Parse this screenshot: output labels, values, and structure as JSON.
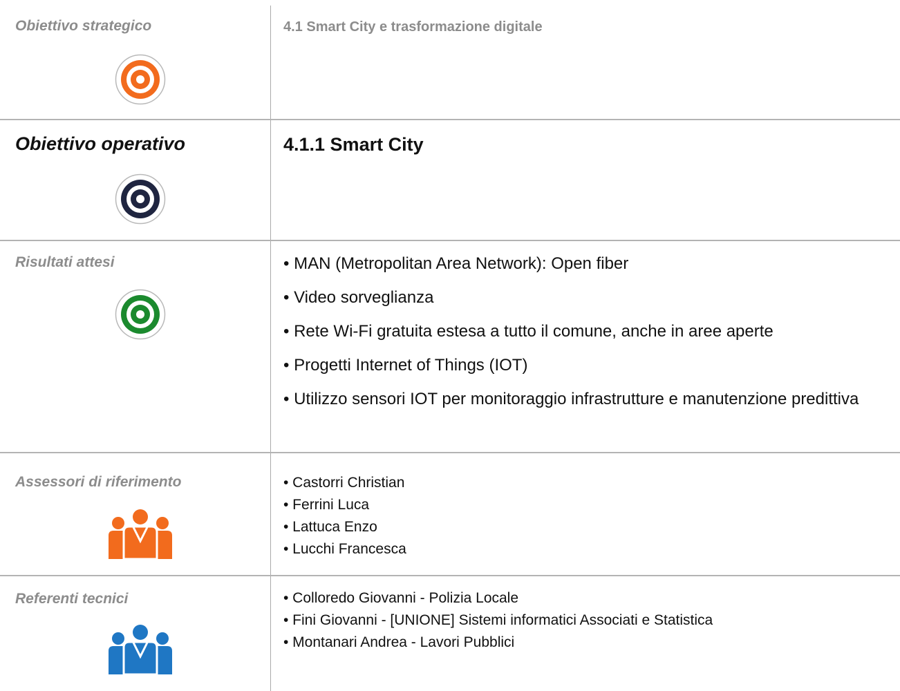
{
  "strategic": {
    "label": "Obiettivo strategico",
    "value": "4.1 Smart City e trasformazione digitale",
    "icon": "target-icon",
    "color": "#F26B1D"
  },
  "operative": {
    "label": "Obiettivo operativo",
    "value": "4.1.1 Smart City",
    "icon": "target-icon",
    "color": "#1F2540"
  },
  "results": {
    "label": "Risultati attesi",
    "icon": "target-icon",
    "color": "#1B8A2E",
    "items": [
      "• MAN (Metropolitan Area Network): Open fiber",
      "• Video sorveglianza",
      "• Rete Wi-Fi gratuita estesa a tutto il comune, anche in aree aperte",
      "• Progetti Internet of Things (IOT)",
      "• Utilizzo sensori IOT per monitoraggio infrastrutture e manutenzione predittiva"
    ]
  },
  "assessors": {
    "label": "Assessori di riferimento",
    "icon": "people-group-icon",
    "color": "#F26B1D",
    "items": [
      "• Castorri Christian",
      "• Ferrini Luca",
      "• Lattuca Enzo",
      "• Lucchi Francesca"
    ]
  },
  "technical": {
    "label": "Referenti tecnici",
    "icon": "people-group-icon",
    "color": "#1F77C4",
    "items": [
      "• Colloredo Giovanni - Polizia Locale",
      "• Fini Giovanni - [UNIONE] Sistemi informatici Associati e Statistica",
      "• Montanari Andrea - Lavori Pubblici"
    ]
  }
}
